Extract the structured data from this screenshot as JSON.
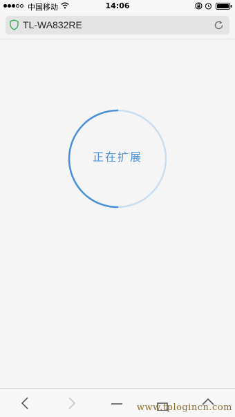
{
  "status_bar": {
    "carrier": "中国移动",
    "time": "14:06"
  },
  "address_bar": {
    "url": "TL-WA832RE"
  },
  "progress": {
    "label": "正在扩展",
    "fraction": 0.5
  },
  "colors": {
    "accent": "#4a90d6",
    "ring_track": "#c9ddf1",
    "secure": "#2ea84a"
  },
  "icons": {
    "status": [
      "wifi-icon",
      "lock-icon",
      "alarm-icon",
      "battery-icon"
    ],
    "address": [
      "shield-icon",
      "reload-icon"
    ],
    "toolbar": [
      "back-icon",
      "forward-icon",
      "share-icon",
      "bookmarks-icon",
      "tabs-icon"
    ]
  },
  "watermark": "www.tplogincn.com"
}
